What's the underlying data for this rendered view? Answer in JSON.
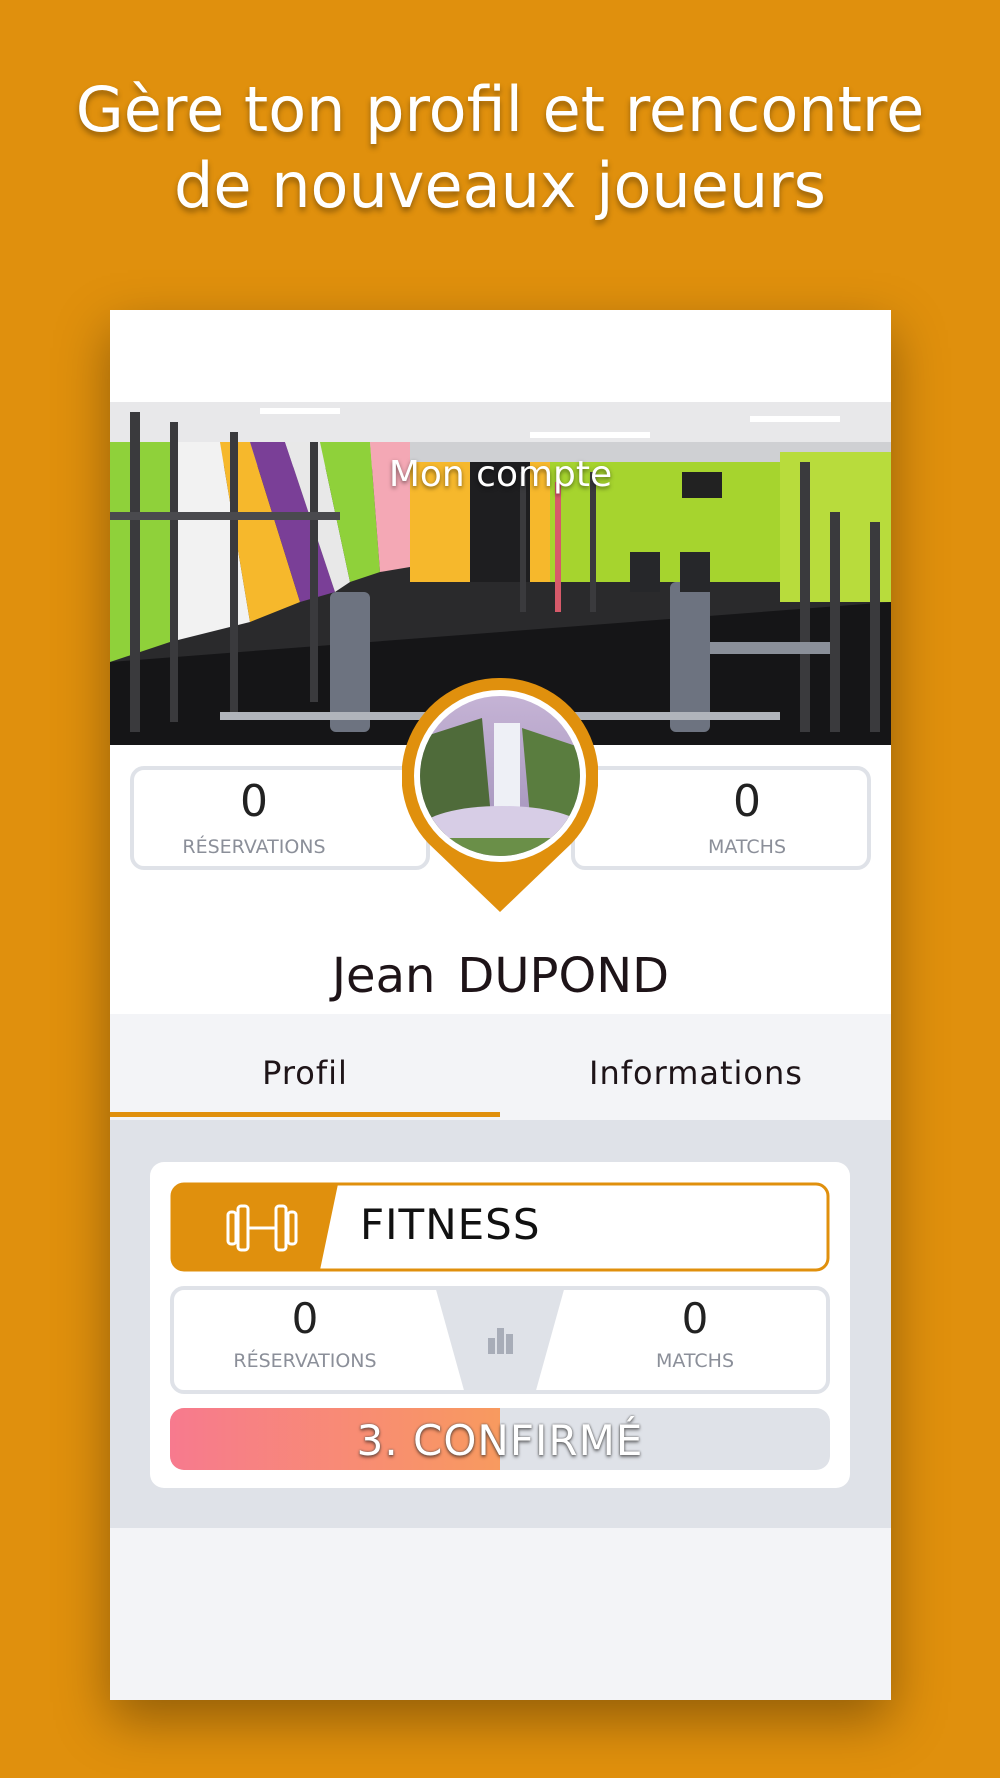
{
  "headline": {
    "line1": "Gère ton profil et rencontre",
    "line2": "de nouveaux joueurs"
  },
  "header": {
    "title": "Mon compte"
  },
  "profile_stats": {
    "reservations": {
      "value": "0",
      "label": "RÉSERVATIONS"
    },
    "matchs": {
      "value": "0",
      "label": "MATCHS"
    }
  },
  "user": {
    "first_name": "Jean",
    "last_name": "DUPOND"
  },
  "tabs": [
    {
      "label": "Profil",
      "active": true
    },
    {
      "label": "Informations",
      "active": false
    }
  ],
  "sport_card": {
    "icon": "dumbbell-icon",
    "sport": "FITNESS",
    "reservations": {
      "value": "0",
      "label": "RÉSERVATIONS"
    },
    "matchs": {
      "value": "0",
      "label": "MATCHS"
    },
    "stats_icon": "bar-chart-icon",
    "level": {
      "label": "3. CONFIRMÉ",
      "progress": 0.5
    }
  },
  "colors": {
    "accent": "#E0900D",
    "card_bg": "#dfe2e8",
    "level_start": "#f77a8e",
    "level_end": "#f89a5f"
  }
}
